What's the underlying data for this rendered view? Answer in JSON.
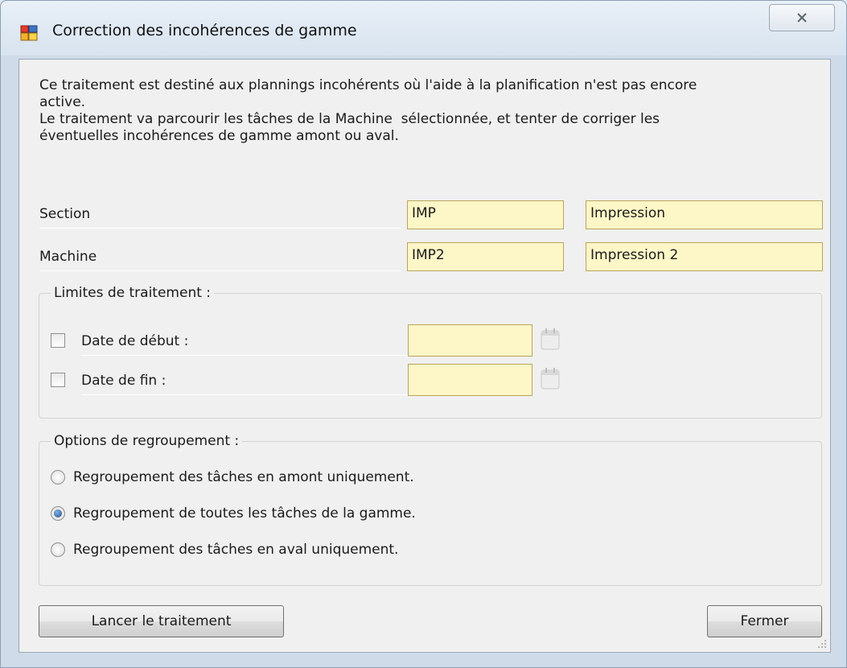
{
  "window": {
    "title": "Correction des incohérences de gamme",
    "close_glyph": "☒"
  },
  "description": "Ce traitement est destiné aux plannings incohérents où l'aide à la planification n'est pas encore\nactive.\nLe traitement va parcourir les tâches de la Machine  sélectionnée, et tenter de corriger les\néventuelles incohérences de gamme amont ou aval.",
  "section": {
    "label": "Section",
    "code": "IMP",
    "name": "Impression"
  },
  "machine": {
    "label": "Machine",
    "code": "IMP2",
    "name": "Impression 2"
  },
  "limits": {
    "title": "Limites de traitement :",
    "start_label": "Date de début :",
    "start_checked": false,
    "start_value": "",
    "end_label": "Date de fin :",
    "end_checked": false,
    "end_value": ""
  },
  "options": {
    "title": "Options de regroupement :",
    "items": [
      {
        "label": "Regroupement des tâches en amont uniquement.",
        "checked": false
      },
      {
        "label": "Regroupement de toutes les tâches de la gamme.",
        "checked": true
      },
      {
        "label": "Regroupement des tâches en aval uniquement.",
        "checked": false
      }
    ]
  },
  "buttons": {
    "run": "Lancer le traitement",
    "close": "Fermer"
  }
}
